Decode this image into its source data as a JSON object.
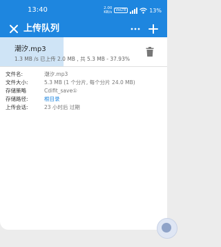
{
  "status_bar": {
    "time": "13:40",
    "speed_value": "2.00",
    "speed_unit": "KB/s",
    "network_badge": "VoLTE",
    "battery": "13%"
  },
  "app_bar": {
    "title": "上传队列",
    "close_icon": "close-icon",
    "more_icon": "more-horizontal-icon",
    "add_icon": "add-icon"
  },
  "upload_item": {
    "file_name": "潮汐.mp3",
    "progress_text": "1.3 MB /s 已上传 2.0 MB , 共 5.3 MB - 37.93%",
    "progress_fraction": 0.3793,
    "delete_icon": "trash-icon"
  },
  "details": {
    "rows": [
      {
        "label": "文件名:",
        "value": "潮汐.mp3"
      },
      {
        "label": "文件大小:",
        "value": "5.3 MB (1 个分片, 每个分片 24.0 MB)"
      },
      {
        "label": "存储策略",
        "value": "Cdifit_save①"
      },
      {
        "label": "存储路径:",
        "value": "根目录"
      },
      {
        "label": "上传会话:",
        "value": "23 小时后 过期"
      }
    ]
  },
  "colors": {
    "primary": "#1e86df",
    "progress": "#cfe4f6",
    "background": "#ececec"
  }
}
